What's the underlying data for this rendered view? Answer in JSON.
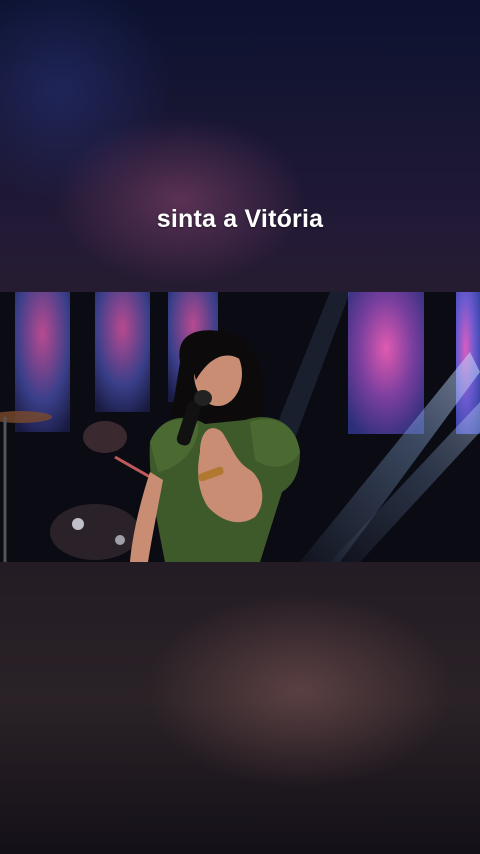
{
  "caption": "sinta a Vitória",
  "scene": {
    "description_icon": "singer-video-frame",
    "colors": {
      "dress": "#3f5a2a",
      "hair": "#0d0a0c",
      "skin": "#c98d74",
      "stage_light": "#8fb6e6",
      "screen_pink": "#c43f8f",
      "screen_blue": "#4a5fc6"
    }
  }
}
